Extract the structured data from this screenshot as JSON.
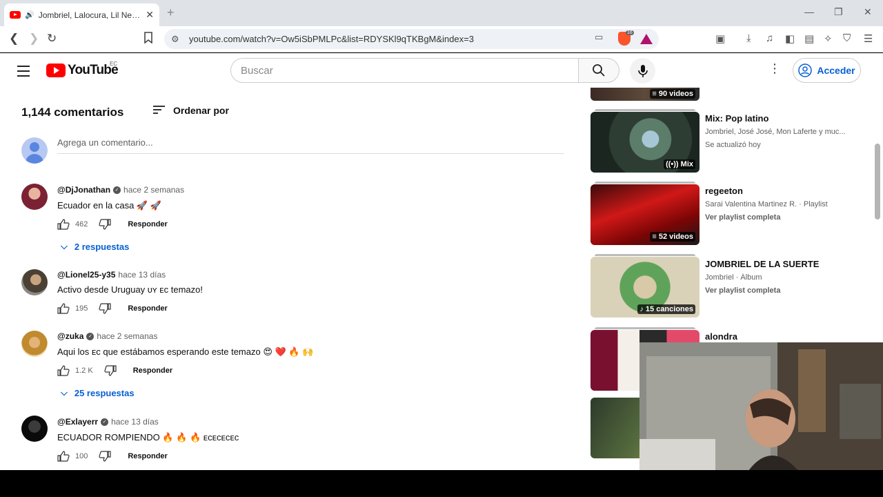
{
  "browser": {
    "tab_title": "Jombriel, Lalocura, Lil New, Ja",
    "new_tab": "+",
    "url": "youtube.com/watch?v=Ow5iSbPMLPc&list=RDYSKl9qTKBgM&index=3",
    "brave_badge": "16"
  },
  "masthead": {
    "logo_text": "YouTube",
    "country_code": "EC",
    "search_placeholder": "Buscar",
    "signin_label": "Acceder"
  },
  "comments_section": {
    "count_label": "1,144 comentarios",
    "sort_label": "Ordenar por",
    "add_placeholder": "Agrega un comentario..."
  },
  "comments": [
    {
      "handle": "@DjJonathan",
      "verified": true,
      "time": "hace 2 semanas",
      "text": "Ecuador en la casa 🚀 🚀",
      "likes": "462",
      "reply_label": "Responder",
      "replies": "2 respuestas"
    },
    {
      "handle": "@Lionel25-y35",
      "verified": false,
      "time": "hace 13 días",
      "text": "Activo desde Uruguay ᴜʏ ᴇᴄ temazo!",
      "likes": "195",
      "reply_label": "Responder",
      "replies": ""
    },
    {
      "handle": "@zuka",
      "verified": true,
      "time": "hace 2 semanas",
      "text": "Aqui los ᴇᴄ que estábamos esperando este temazo 😍 ❤️ 🔥 🙌",
      "likes": "1.2 K",
      "reply_label": "Responder",
      "replies": "25 respuestas"
    },
    {
      "handle": "@Exlayerr",
      "verified": true,
      "time": "hace 13 días",
      "text": "ECUADOR ROMPIENDO 🔥 🔥 🔥 ᴇᴄᴇᴄᴇᴄᴇᴄ",
      "likes": "100",
      "reply_label": "Responder",
      "replies": ""
    }
  ],
  "sidebar": [
    {
      "title": "",
      "meta": "",
      "extra": "",
      "badge": "90 videos"
    },
    {
      "title": "Mix: Pop latino",
      "meta": "Jombriel, José José, Mon Laferte y muc...",
      "extra": "Se actualizó hoy",
      "badge": "Mix"
    },
    {
      "title": "regeeton",
      "meta": "Sarai Valentina Martinez R. · Playlist",
      "extra": "Ver playlist completa",
      "badge": "52 videos"
    },
    {
      "title": "JOMBRIEL DE LA SUERTE",
      "meta": "Jombriel · Álbum",
      "extra": "Ver playlist completa",
      "badge": "15 canciones"
    },
    {
      "title": "alondra",
      "meta": "",
      "extra": "",
      "badge": ""
    }
  ],
  "colors": {
    "youtube_red": "#ff0000",
    "link_blue": "#065fd4",
    "tab_strip": "#dfe3e8"
  }
}
